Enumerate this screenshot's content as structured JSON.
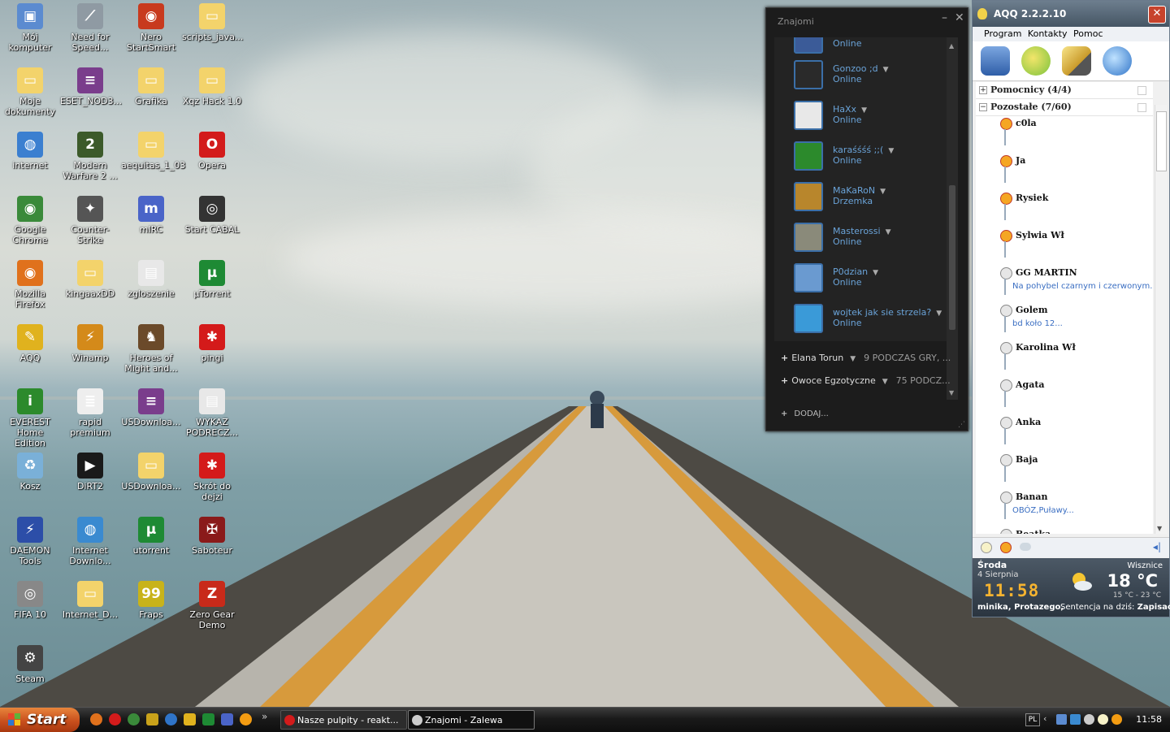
{
  "desktop_icons": [
    {
      "label": "Mój komputer",
      "icon": "my-computer-icon",
      "color": "#5b8bd0",
      "glyph": "▣"
    },
    {
      "label": "Need for Speed...",
      "icon": "need-for-speed-icon",
      "color": "#8f9aa3",
      "glyph": "⟋"
    },
    {
      "label": "Nero StartSmart",
      "icon": "nero-icon",
      "color": "#c83a1e",
      "glyph": "◉"
    },
    {
      "label": "scripts_java...",
      "icon": "folder-icon",
      "color": "#f3d36b",
      "glyph": "▭"
    },
    {
      "label": "Moje dokumenty",
      "icon": "my-documents-icon",
      "color": "#f3d36b",
      "glyph": "▭"
    },
    {
      "label": "ESET_NOD3...",
      "icon": "winrar-icon",
      "color": "#7a3d8c",
      "glyph": "≡"
    },
    {
      "label": "Grafika",
      "icon": "folder-icon",
      "color": "#f3d36b",
      "glyph": "▭"
    },
    {
      "label": "Xqz Hack 1.0",
      "icon": "folder-icon",
      "color": "#f3d36b",
      "glyph": "▭"
    },
    {
      "label": "internet",
      "icon": "internet-icon",
      "color": "#3b7fd0",
      "glyph": "◍"
    },
    {
      "label": "Modern Warfare 2 ...",
      "icon": "modern-warfare-icon",
      "color": "#3c5a2a",
      "glyph": "2"
    },
    {
      "label": "aequitas_1_03",
      "icon": "folder-icon",
      "color": "#f3d36b",
      "glyph": "▭"
    },
    {
      "label": "Opera",
      "icon": "opera-icon",
      "color": "#d31b1b",
      "glyph": "O"
    },
    {
      "label": "Google Chrome",
      "icon": "chrome-icon",
      "color": "#3a8a3a",
      "glyph": "◉"
    },
    {
      "label": "Counter-Strike",
      "icon": "counter-strike-icon",
      "color": "#555555",
      "glyph": "✦"
    },
    {
      "label": "mIRC",
      "icon": "mirc-icon",
      "color": "#4a64c8",
      "glyph": "m"
    },
    {
      "label": "Start CABAL",
      "icon": "cabal-icon",
      "color": "#333333",
      "glyph": "◎"
    },
    {
      "label": "Mozilla Firefox",
      "icon": "firefox-icon",
      "color": "#e0711c",
      "glyph": "◉"
    },
    {
      "label": "kingaaxDD",
      "icon": "folder-icon",
      "color": "#f3d36b",
      "glyph": "▭"
    },
    {
      "label": "zgloszenie",
      "icon": "pdf-icon",
      "color": "#e8e8e8",
      "glyph": "▤"
    },
    {
      "label": "µTorrent",
      "icon": "utorrent-icon",
      "color": "#1e8a34",
      "glyph": "µ"
    },
    {
      "label": "AQQ",
      "icon": "aqq-icon",
      "color": "#e0b21e",
      "glyph": "✎"
    },
    {
      "label": "Winamp",
      "icon": "winamp-icon",
      "color": "#d48a1a",
      "glyph": "⚡"
    },
    {
      "label": "Heroes of Might and...",
      "icon": "heroes-icon",
      "color": "#6b4a2a",
      "glyph": "♞"
    },
    {
      "label": "pingi",
      "icon": "pingi-icon",
      "color": "#d41a1a",
      "glyph": "✱"
    },
    {
      "label": "EVEREST Home Edition",
      "icon": "everest-icon",
      "color": "#2c8a2c",
      "glyph": "i"
    },
    {
      "label": "rapid premium",
      "icon": "text-file-icon",
      "color": "#eeeeee",
      "glyph": "≣"
    },
    {
      "label": "USDownloa...",
      "icon": "winrar-icon",
      "color": "#7a3d8c",
      "glyph": "≡"
    },
    {
      "label": "WYKAZ PODRECZ...",
      "icon": "pdf-icon",
      "color": "#e8e8e8",
      "glyph": "▤"
    },
    {
      "label": "Kosz",
      "icon": "recycle-bin-icon",
      "color": "#7ab0d8",
      "glyph": "♻"
    },
    {
      "label": "DiRT2",
      "icon": "dirt2-icon",
      "color": "#1a1a1a",
      "glyph": "▶"
    },
    {
      "label": "USDownloa...",
      "icon": "folder-icon",
      "color": "#f3d36b",
      "glyph": "▭"
    },
    {
      "label": "Skrót do dejzi",
      "icon": "pingi-icon",
      "color": "#d41a1a",
      "glyph": "✱"
    },
    {
      "label": "DAEMON Tools",
      "icon": "daemon-tools-icon",
      "color": "#2c4ea8",
      "glyph": "⚡"
    },
    {
      "label": "Internet Downlo...",
      "icon": "idm-icon",
      "color": "#3a8ad0",
      "glyph": "◍"
    },
    {
      "label": "utorrent",
      "icon": "utorrent-icon",
      "color": "#1e8a34",
      "glyph": "µ"
    },
    {
      "label": "Saboteur",
      "icon": "saboteur-icon",
      "color": "#8a1a1a",
      "glyph": "✠"
    },
    {
      "label": "FIFA 10",
      "icon": "fifa-icon",
      "color": "#888888",
      "glyph": "◎"
    },
    {
      "label": "Internet_D...",
      "icon": "folder-icon",
      "color": "#f3d36b",
      "glyph": "▭"
    },
    {
      "label": "Fraps",
      "icon": "fraps-icon",
      "color": "#c8b31a",
      "glyph": "99"
    },
    {
      "label": "Zero Gear Demo",
      "icon": "zero-gear-icon",
      "color": "#c82a1a",
      "glyph": "Z"
    },
    {
      "label": "Steam",
      "icon": "steam-icon",
      "color": "#444444",
      "glyph": "⚙"
    }
  ],
  "znajomi": {
    "title": "Znajomi",
    "contacts": [
      {
        "name": "",
        "status": "Online",
        "avatar": "#3b5b98"
      },
      {
        "name": "Gonzoo ;d",
        "status": "Online",
        "avatar": "#2a2a2a"
      },
      {
        "name": "HaXx",
        "status": "Online",
        "avatar": "#e8e8e8"
      },
      {
        "name": "karaśśśś ;;(",
        "status": "Online",
        "avatar": "#2c8a2c"
      },
      {
        "name": "MaKaRoN",
        "status": "Drzemka",
        "avatar": "#b8862c"
      },
      {
        "name": "Masterossi",
        "status": "Online",
        "avatar": "#8a8a7a"
      },
      {
        "name": "P0dzian",
        "status": "Online",
        "avatar": "#6a9ad0"
      },
      {
        "name": "wojtek jak sie strzela?",
        "status": "Online",
        "avatar": "#3a9ad8"
      }
    ],
    "groups": [
      {
        "name": "Elana Torun",
        "count": "9 PODCZAS GRY, ..."
      },
      {
        "name": "Owoce Egzotyczne",
        "count": "75 PODCZ..."
      }
    ],
    "add_label": "DODAJ..."
  },
  "aqq": {
    "title": "AQQ 2.2.2.10",
    "menu": [
      "Program",
      "Kontakty",
      "Pomoc"
    ],
    "groups": [
      {
        "label": "Pomocnicy (4/4)",
        "sign": "+"
      },
      {
        "label": "Pozostałe (7/60)",
        "sign": "−"
      }
    ],
    "contacts": [
      {
        "name": "c0la",
        "desc": "",
        "online": true
      },
      {
        "name": "Ja",
        "desc": "",
        "online": true
      },
      {
        "name": "Rysiek",
        "desc": "",
        "online": true
      },
      {
        "name": "Sylwia Wł",
        "desc": "",
        "online": true
      },
      {
        "name": "GG MARTIN",
        "desc": "Na pohybel czarnym i czerwonym.",
        "online": false
      },
      {
        "name": "Golem",
        "desc": "bd koło 12...",
        "online": false
      },
      {
        "name": "Karolina Wł",
        "desc": "",
        "online": false
      },
      {
        "name": "Agata",
        "desc": "",
        "online": false
      },
      {
        "name": "Anka",
        "desc": "",
        "online": false
      },
      {
        "name": "Baja",
        "desc": "",
        "online": false
      },
      {
        "name": "Banan",
        "desc": "OBÓZ,Puławy...",
        "online": false
      },
      {
        "name": "Beatka",
        "desc": "",
        "online": false
      }
    ],
    "weather": {
      "day": "Środa",
      "date": "4 Sierpnia",
      "clock": "11:58",
      "town": "Wisznice",
      "temp": "18 °C",
      "range": "15 °C - 23 °C",
      "names": "minika, Protazego,",
      "sentence_prefix": "Sentencja na dziś:",
      "sentence_link": "Zapisać si"
    }
  },
  "taskbar": {
    "start_label": "Start",
    "quick_overflow": "»",
    "tasks": [
      {
        "label": "Nasze pulpity - reakt...",
        "active": false,
        "icon": "opera-icon",
        "color": "#d31b1b"
      },
      {
        "label": "Znajomi - Zalewa",
        "active": true,
        "icon": "steam-icon",
        "color": "#cccccc"
      }
    ],
    "lang": "PL",
    "clock": "11:58"
  }
}
